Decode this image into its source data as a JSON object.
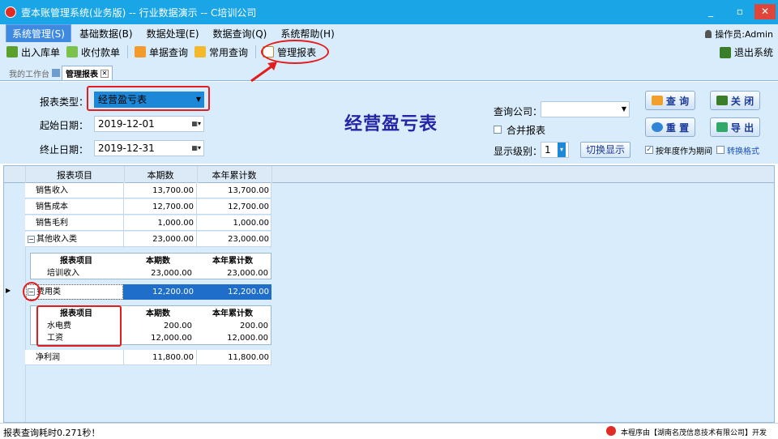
{
  "window": {
    "title": "壹本账管理系统(业务版) -- 行业数据演示 -- C培训公司"
  },
  "menu": [
    "系统管理(S)",
    "基础数据(B)",
    "数据处理(E)",
    "数据查询(Q)",
    "系统帮助(H)"
  ],
  "operator": "操作员:Admin",
  "toolbar": {
    "items": [
      "出入库单",
      "收付款单",
      "单据查询",
      "常用查询",
      "管理报表"
    ],
    "exit": "退出系统"
  },
  "tabs": [
    "我的工作台",
    "管理报表"
  ],
  "form": {
    "report_type_label": "报表类型：",
    "report_type_value": "经营盈亏表",
    "start_date_label": "起始日期：",
    "start_date_value": "2019-12-01",
    "end_date_label": "终止日期：",
    "end_date_value": "2019-12-31",
    "title": "经营盈亏表",
    "company_label": "查询公司：",
    "company_value": "",
    "merge_label": "合并报表",
    "level_label": "显示级别：",
    "level_value": "1",
    "switch_button": "切换显示",
    "year_period_label": "按年度作为期间",
    "switch_format_label": "转换格式",
    "query_button": "查 询",
    "close_button": "关 闭",
    "reset_button": "重 置",
    "export_button": "导 出"
  },
  "table": {
    "headers": [
      "报表项目",
      "本期数",
      "本年累计数"
    ],
    "rows": [
      {
        "item": "销售收入",
        "current": "13,700.00",
        "ytd": "13,700.00"
      },
      {
        "item": "销售成本",
        "current": "12,700.00",
        "ytd": "12,700.00"
      },
      {
        "item": "销售毛利",
        "current": "1,000.00",
        "ytd": "1,000.00"
      },
      {
        "item": "其他收入类",
        "current": "23,000.00",
        "ytd": "23,000.00"
      }
    ],
    "sub1": {
      "headers": [
        "报表项目",
        "本期数",
        "本年累计数"
      ],
      "rows": [
        {
          "item": "培训收入",
          "current": "23,000.00",
          "ytd": "23,000.00"
        }
      ]
    },
    "expense_row": {
      "item": "费用类",
      "current": "12,200.00",
      "ytd": "12,200.00"
    },
    "sub2": {
      "headers": [
        "报表项目",
        "本期数",
        "本年累计数"
      ],
      "rows": [
        {
          "item": "水电费",
          "current": "200.00",
          "ytd": "200.00"
        },
        {
          "item": "工资",
          "current": "12,000.00",
          "ytd": "12,000.00"
        }
      ]
    },
    "net_row": {
      "item": "净利润",
      "current": "11,800.00",
      "ytd": "11,800.00"
    }
  },
  "status": {
    "left": "报表查询耗时0.271秒！",
    "right": "本程序由【湖南名茂信息技术有限公司】开发"
  },
  "colors": {
    "titlebar": "#1aa6e6",
    "panel": "#d9ecfb",
    "selected_row": "#1f6ec9",
    "highlight": "#e31d1d",
    "report_title": "#2424a6"
  }
}
